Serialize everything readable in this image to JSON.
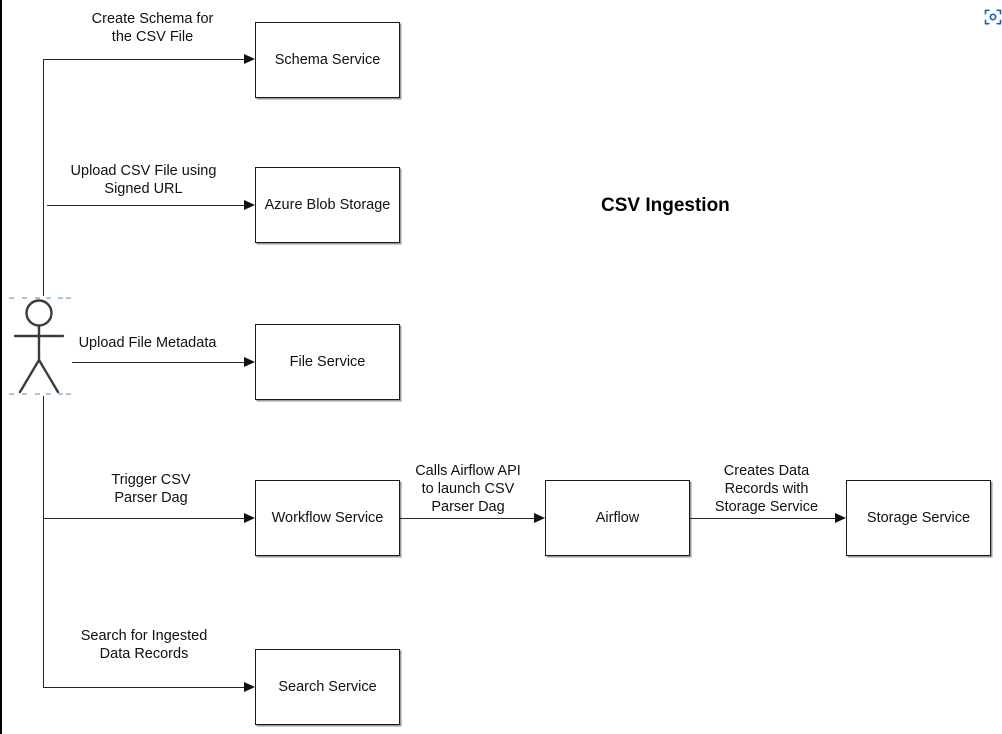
{
  "diagram": {
    "title": "CSV Ingestion",
    "background_color": "#ffffff",
    "line_color": "#262626",
    "box_border_color": "#1a1a1a",
    "accent_color": "#1565c0"
  },
  "actor": {
    "name": "user-actor",
    "selected": true
  },
  "nodes": [
    {
      "id": "schema-service",
      "label": "Schema Service"
    },
    {
      "id": "azure-blob-storage",
      "label": "Azure Blob Storage"
    },
    {
      "id": "file-service",
      "label": "File Service"
    },
    {
      "id": "workflow-service",
      "label": "Workflow Service"
    },
    {
      "id": "airflow",
      "label": "Airflow"
    },
    {
      "id": "storage-service",
      "label": "Storage Service"
    },
    {
      "id": "search-service",
      "label": "Search Service"
    }
  ],
  "edges": [
    {
      "id": "edge-create-schema",
      "label": "Create Schema for\nthe CSV File"
    },
    {
      "id": "edge-upload-csv",
      "label": "Upload CSV File using\nSigned URL"
    },
    {
      "id": "edge-upload-metadata",
      "label": "Upload File Metadata"
    },
    {
      "id": "edge-trigger-parser",
      "label": "Trigger CSV\nParser Dag"
    },
    {
      "id": "edge-calls-airflow",
      "label": "Calls Airflow API\nto launch CSV\nParser Dag"
    },
    {
      "id": "edge-creates-records",
      "label": "Creates Data\nRecords with\nStorage Service"
    },
    {
      "id": "edge-search-records",
      "label": "Search for Ingested\nData Records"
    }
  ],
  "toolbar": {
    "scan_icon": "scan-focus-icon"
  }
}
